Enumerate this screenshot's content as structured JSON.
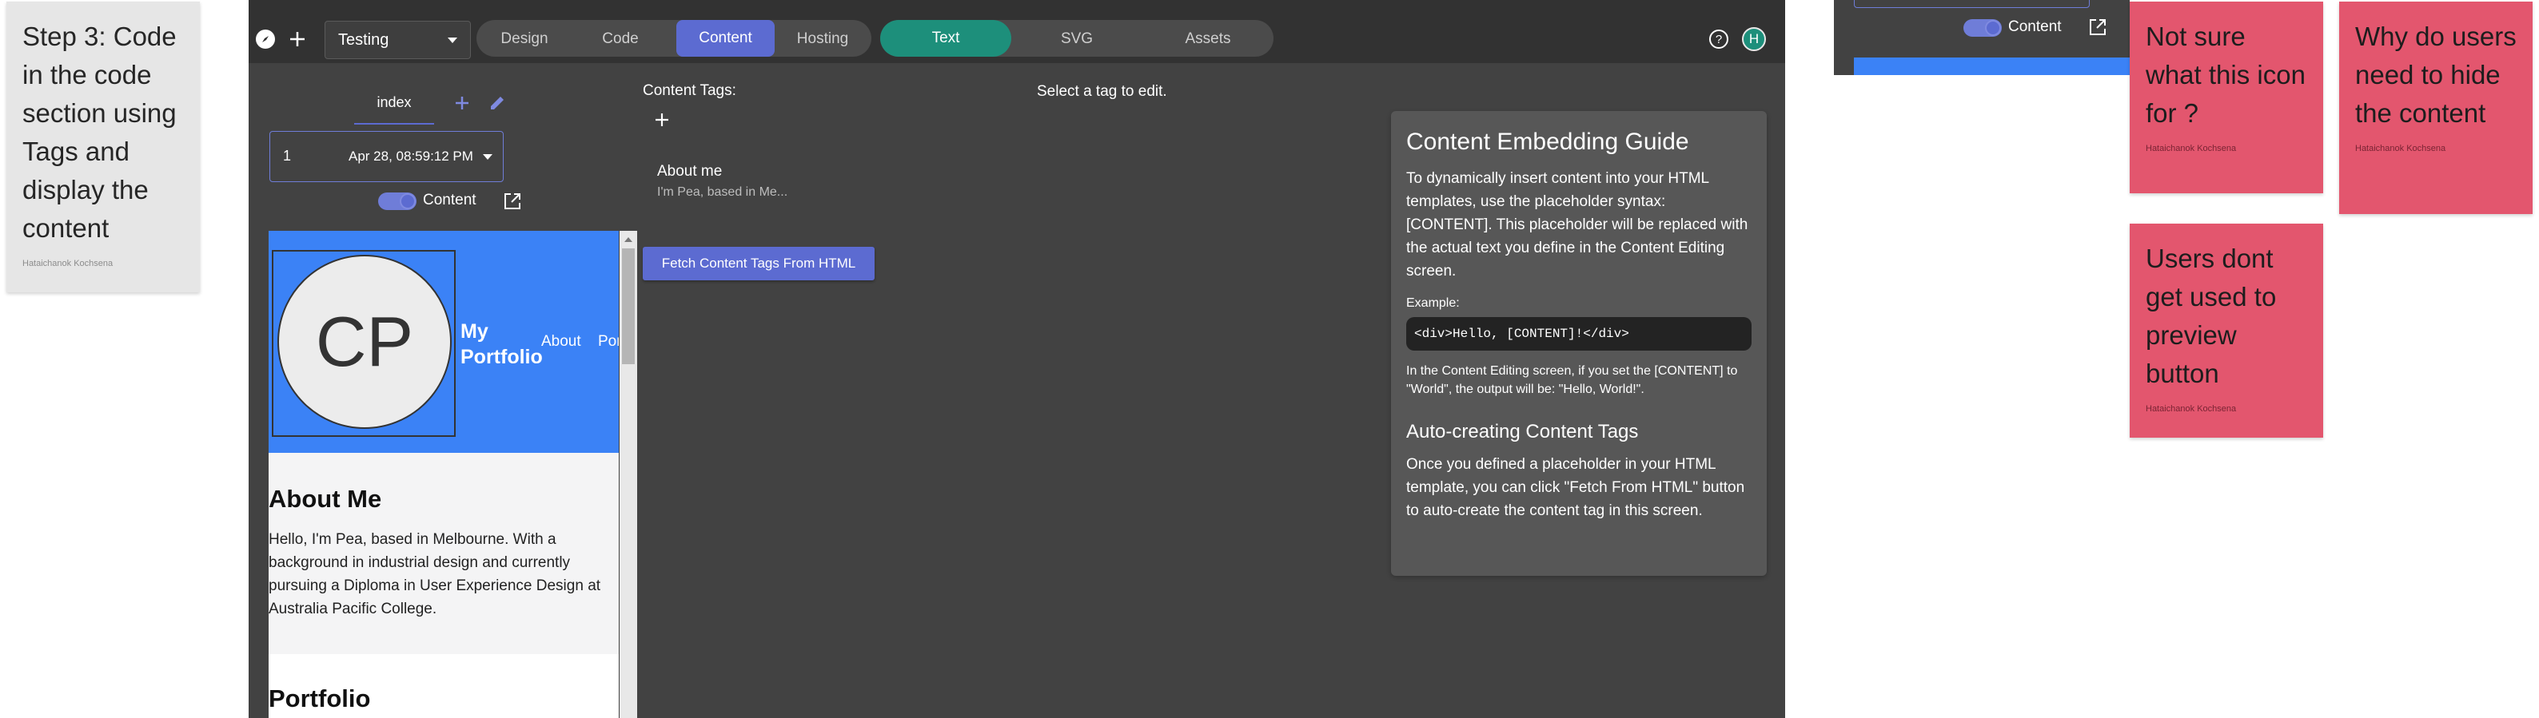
{
  "notes": {
    "step3": {
      "text": "Step 3: Code in the code section using Tags and display the content",
      "author": "Hataichanok Kochsena"
    },
    "icon": {
      "text": "Not sure what this icon for ?",
      "author": "Hataichanok Kochsena"
    },
    "hide": {
      "text": "Why do users need to hide the content",
      "author": "Hataichanok Kochsena"
    },
    "preview": {
      "text": "Users dont get used to preview button",
      "author": "Hataichanok Kochsena"
    }
  },
  "topbar": {
    "project": "Testing",
    "tabs": [
      "Design",
      "Code",
      "Content",
      "Hosting"
    ],
    "active_tab": "Content",
    "subtabs": [
      "Text",
      "SVG",
      "Assets"
    ],
    "active_subtab": "Text",
    "avatar": "H"
  },
  "page_panel": {
    "page_tab": "index",
    "version_num": "1",
    "version_date": "Apr 28, 08:59:12 PM",
    "toggle_label": "Content"
  },
  "tags_panel": {
    "title": "Content Tags:",
    "tag_name": "About me",
    "tag_preview": "I'm Pea, based in Me...",
    "fetch_label": "Fetch Content Tags From HTML"
  },
  "editor": {
    "hint": "Select a tag to edit."
  },
  "guide": {
    "title": "Content Embedding Guide",
    "intro": "To dynamically insert content into your HTML templates, use the placeholder syntax: [CONTENT]. This placeholder will be replaced with the actual text you define in the Content Editing screen.",
    "example_label": "Example:",
    "example_code": "<div>Hello, [CONTENT]!</div>",
    "example_note": "In the Content Editing screen, if you set the [CONTENT] to \"World\", the output will be: \"Hello, World!\".",
    "auto_title": "Auto-creating Content Tags",
    "auto_text": "Once you defined a placeholder in your HTML template, you can click \"Fetch From HTML\" button to auto-create the content tag in this screen."
  },
  "preview": {
    "logo": "CP",
    "brand": "My Portfolio",
    "nav": [
      "About",
      "Portfolio"
    ],
    "about_title": "About Me",
    "about_text": "Hello, I'm Pea, based in Melbourne. With a background in industrial design and currently pursuing a Diploma in User Experience Design at Australia Pacific College.",
    "portfolio_title": "Portfolio"
  },
  "right_frame": {
    "toggle_label": "Content"
  },
  "colors": {
    "accent": "#5c6bd1",
    "teal": "#1d8f7b",
    "blue": "#3b82f6",
    "sticky_red": "#e3566e",
    "sticky_grey": "#e6e6e6",
    "app_bg": "#424242"
  }
}
